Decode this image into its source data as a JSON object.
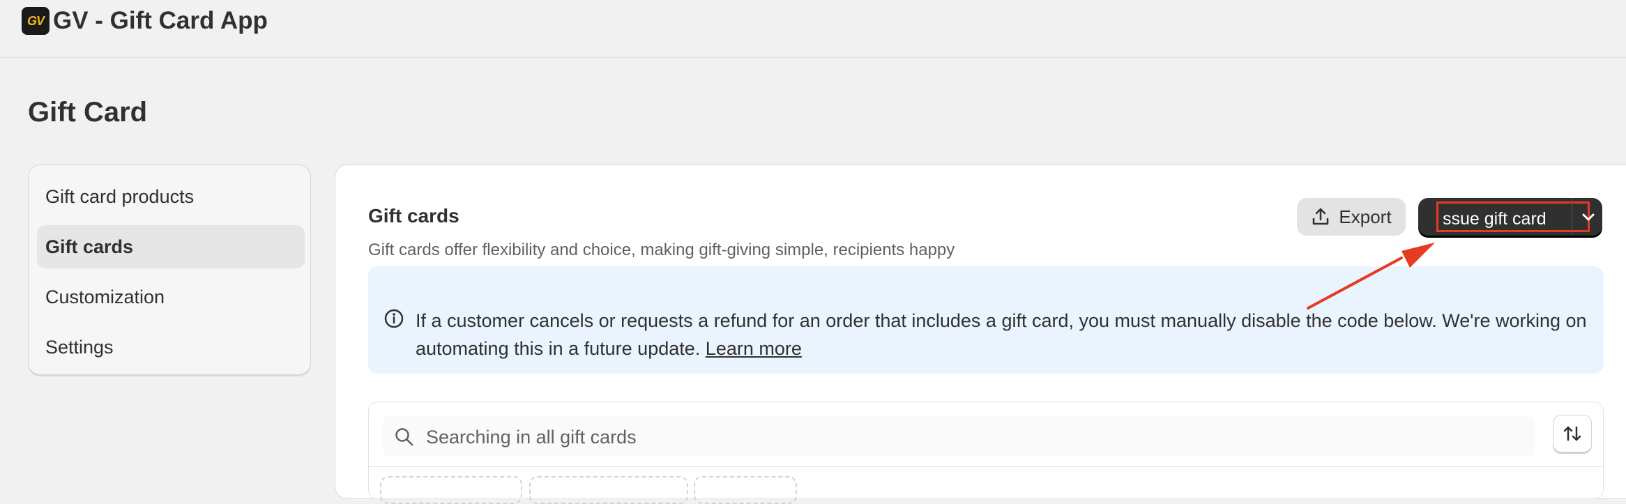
{
  "app": {
    "logo_text": "GV",
    "title": "GV - Gift Card App"
  },
  "page": {
    "title": "Gift Card"
  },
  "sidebar": {
    "items": [
      {
        "label": "Gift card products",
        "active": false
      },
      {
        "label": "Gift cards",
        "active": true
      },
      {
        "label": "Customization",
        "active": false
      },
      {
        "label": "Settings",
        "active": false
      }
    ]
  },
  "section": {
    "title": "Gift cards",
    "subtitle": "Gift cards offer flexibility and choice, making gift-giving simple, recipients happy"
  },
  "toolbar": {
    "export_label": "Export",
    "issue_label": "ssue gift card"
  },
  "banner": {
    "text": "If a customer cancels or requests a refund for an order that includes a gift card, you must manually disable the code below. We're working on automating this in a future update.",
    "link": "Learn more"
  },
  "search": {
    "placeholder": "Searching in all gift cards"
  },
  "colors": {
    "accent_dark": "#303030",
    "highlight_red": "#e53a23",
    "banner_bg": "#eaf4ff",
    "logo_yellow": "#f0b51c"
  },
  "icons": [
    "gv-logo",
    "upload-icon",
    "chevron-down-icon",
    "info-icon",
    "search-icon",
    "sort-icon",
    "annotation-arrow"
  ]
}
